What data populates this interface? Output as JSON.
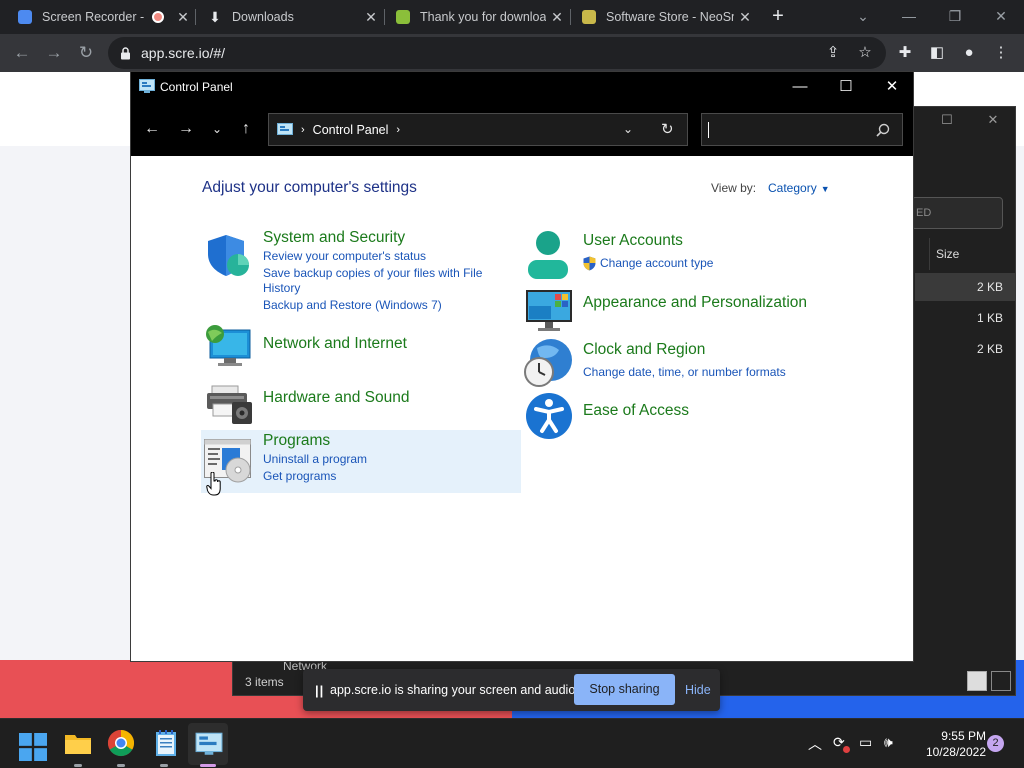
{
  "browser": {
    "tabs": [
      {
        "label": "Screen Recorder -",
        "recording": true
      },
      {
        "label": "Downloads"
      },
      {
        "label": "Thank you for downloa"
      },
      {
        "label": "Software Store - NeoSm"
      }
    ],
    "url": "app.scre.io/#/"
  },
  "explorer": {
    "column_size": "Size",
    "search_partial": "ED",
    "sizes": [
      "2 KB",
      "1 KB",
      "2 KB"
    ],
    "status": "3 items",
    "nav_partial": "Network"
  },
  "control_panel": {
    "window_title": "Control Panel",
    "address": "Control Panel",
    "heading": "Adjust your computer's settings",
    "view_by_label": "View by:",
    "view_by_value": "Category",
    "left": [
      {
        "title": "System and Security",
        "links": [
          "Review your computer's status",
          "Save backup copies of your files with File",
          "History",
          "Backup and Restore (Windows 7)"
        ]
      },
      {
        "title": "Network and Internet",
        "links": []
      },
      {
        "title": "Hardware and Sound",
        "links": []
      },
      {
        "title": "Programs",
        "links": [
          "Uninstall a program",
          "Get programs"
        ]
      }
    ],
    "right": [
      {
        "title": "User Accounts",
        "links": [
          "Change account type"
        ]
      },
      {
        "title": "Appearance and Personalization",
        "links": []
      },
      {
        "title": "Clock and Region",
        "links": [
          "Change date, time, or number formats"
        ]
      },
      {
        "title": "Ease of Access",
        "links": []
      }
    ]
  },
  "share_bar": {
    "message": "app.scre.io is sharing your screen and audio.",
    "stop_label": "Stop sharing",
    "hide_label": "Hide"
  },
  "taskbar": {
    "time": "9:55 PM",
    "date": "10/28/2022",
    "notifications": "2"
  }
}
